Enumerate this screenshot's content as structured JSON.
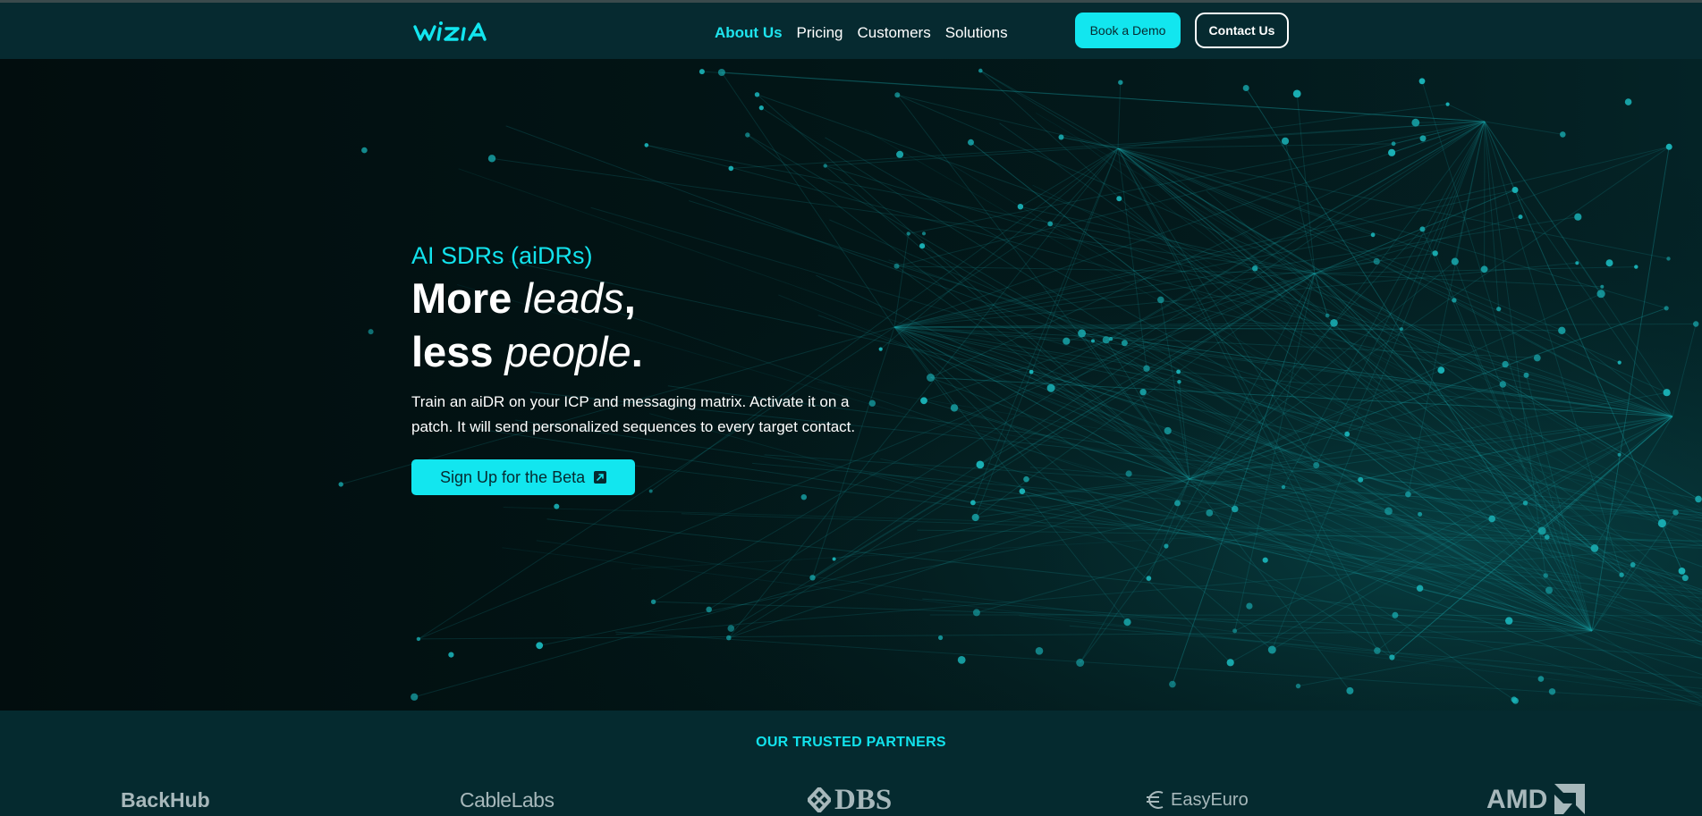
{
  "brand": {
    "logo_text": "wizia",
    "accent": "#12e6ef"
  },
  "nav": {
    "links": [
      {
        "label": "About Us",
        "active": true
      },
      {
        "label": "Pricing",
        "active": false
      },
      {
        "label": "Customers",
        "active": false
      },
      {
        "label": "Solutions",
        "active": false
      }
    ],
    "book_demo": "Book a Demo",
    "contact": "Contact Us"
  },
  "hero": {
    "eyebrow": "AI SDRs (aiDRs)",
    "headline_1a": "More ",
    "headline_1b": "leads",
    "headline_1c": ",",
    "headline_2a": "less ",
    "headline_2b": "people",
    "headline_2c": ".",
    "description": "Train an aiDR on your ICP and messaging matrix. Activate it on a patch. It will send personalized sequences to every target contact.",
    "cta_label": "Sign Up for the Beta",
    "cta_icon": "external-link-icon"
  },
  "partners": {
    "title": "OUR TRUSTED PARTNERS",
    "logos": [
      "BackHub",
      "CableLabs",
      "DBS",
      "EasyEuro",
      "AMD"
    ]
  }
}
